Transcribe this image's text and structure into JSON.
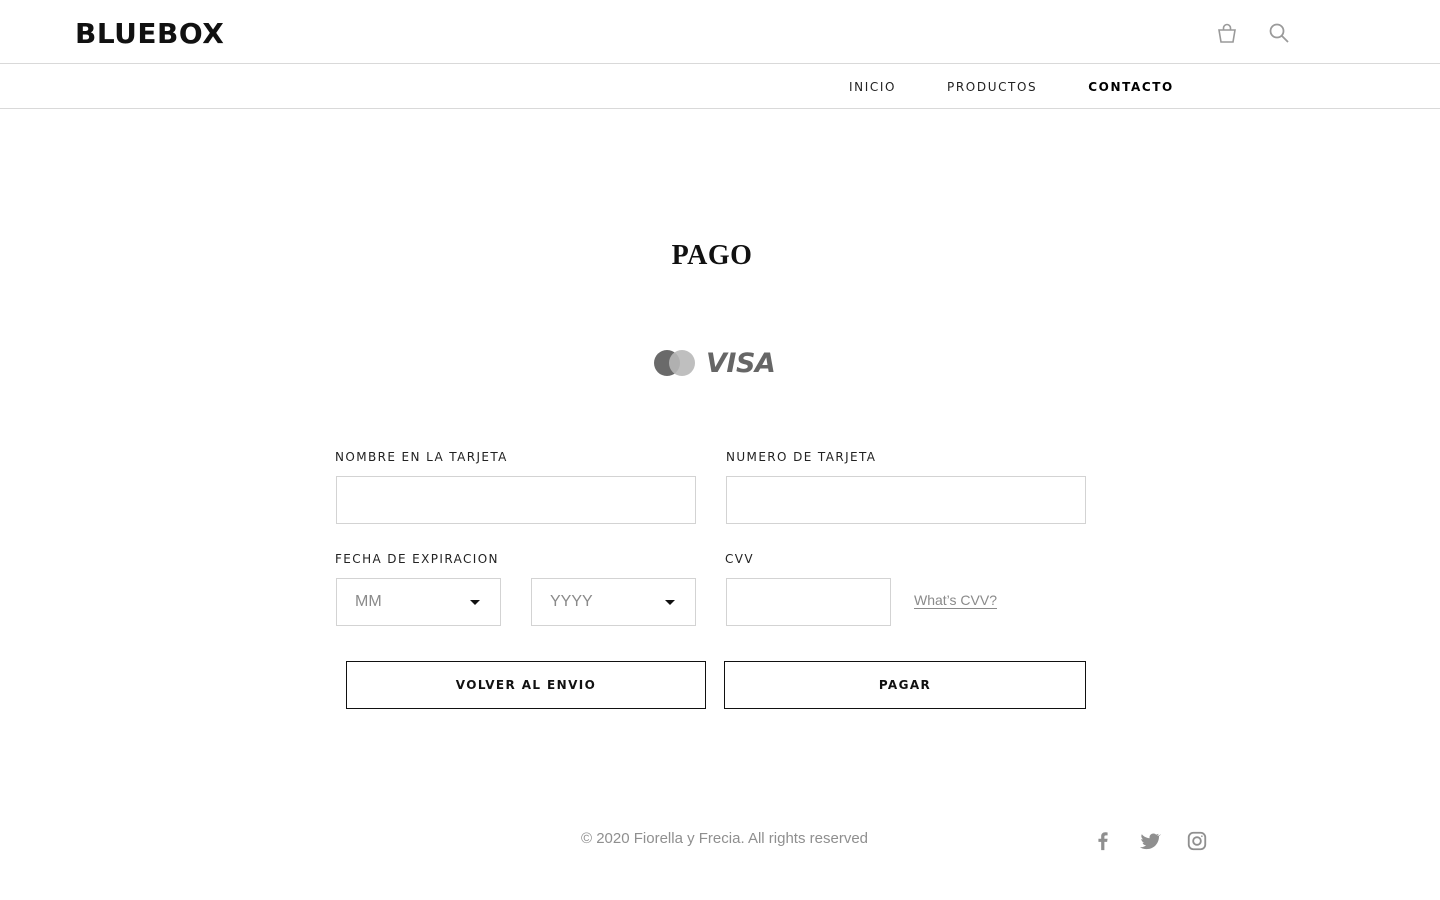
{
  "header": {
    "brand": "BLUEBOX",
    "icons": [
      "shopping-bag-icon",
      "search-icon"
    ]
  },
  "nav": {
    "items": [
      {
        "label": "INICIO",
        "active": false
      },
      {
        "label": "PRODUCTOS",
        "active": false
      },
      {
        "label": "CONTACTO",
        "active": true
      }
    ]
  },
  "main": {
    "title": "PAGO",
    "card_logos": {
      "visa": "VISA",
      "icons": [
        "mastercard-icon"
      ]
    },
    "form": {
      "name_label": "NOMBRE EN LA TARJETA",
      "name_value": "",
      "number_label": "NUMERO DE TARJETA",
      "number_value": "",
      "expiry_label": "FECHA DE EXPIRACION",
      "month_placeholder": "MM",
      "year_placeholder": "YYYY",
      "cvv_label": "CVV",
      "cvv_value": "",
      "cvv_help": "What’s CVV?"
    },
    "buttons": {
      "back_label": "VOLVER AL ENVIO",
      "pay_label": "PAGAR"
    }
  },
  "footer": {
    "copyright": "© 2020 Fiorella y Frecia. All rights reserved",
    "social_icons": [
      "facebook-icon",
      "twitter-icon",
      "instagram-icon"
    ]
  },
  "colors": {
    "text": "#111111",
    "muted": "#8f8f8f",
    "border": "#d3d3d3"
  }
}
